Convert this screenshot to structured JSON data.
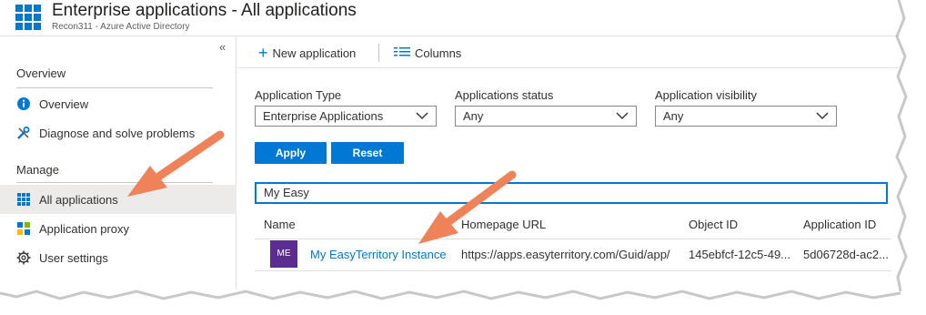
{
  "header": {
    "title": "Enterprise applications - All applications",
    "subtitle": "Recon311 - Azure Active Directory",
    "icon": "enterprise-apps-grid-icon"
  },
  "sidebar": {
    "collapse_glyph": "«",
    "sections": [
      {
        "heading": "Overview"
      },
      {
        "heading": "Manage"
      }
    ],
    "items": [
      {
        "label": "Overview",
        "icon": "info-icon"
      },
      {
        "label": "Diagnose and solve problems",
        "icon": "wrench-icon"
      },
      {
        "label": "All applications",
        "icon": "apps-grid-icon",
        "selected": true
      },
      {
        "label": "Application proxy",
        "icon": "app-proxy-icon"
      },
      {
        "label": "User settings",
        "icon": "gear-icon"
      }
    ]
  },
  "toolbar": {
    "new_application": "New application",
    "columns": "Columns"
  },
  "filters": {
    "application_type": {
      "label": "Application Type",
      "value": "Enterprise Applications"
    },
    "applications_status": {
      "label": "Applications status",
      "value": "Any"
    },
    "application_visibility": {
      "label": "Application visibility",
      "value": "Any"
    },
    "apply": "Apply",
    "reset": "Reset"
  },
  "search": {
    "value": "My Easy"
  },
  "table": {
    "columns": [
      "Name",
      "Homepage URL",
      "Object ID",
      "Application ID"
    ],
    "rows": [
      {
        "avatar": "ME",
        "name": "My EasyTerritory Instance",
        "homepage_url": "https://apps.easyterritory.com/Guid/app/",
        "object_id": "145ebfcf-12c5-49...",
        "application_id": "5d06728d-ac2..."
      }
    ]
  },
  "colors": {
    "accent": "#0078d4",
    "avatar": "#5c2d91",
    "annotation_arrow": "#f0825a",
    "selected_bg": "#edebe9"
  }
}
